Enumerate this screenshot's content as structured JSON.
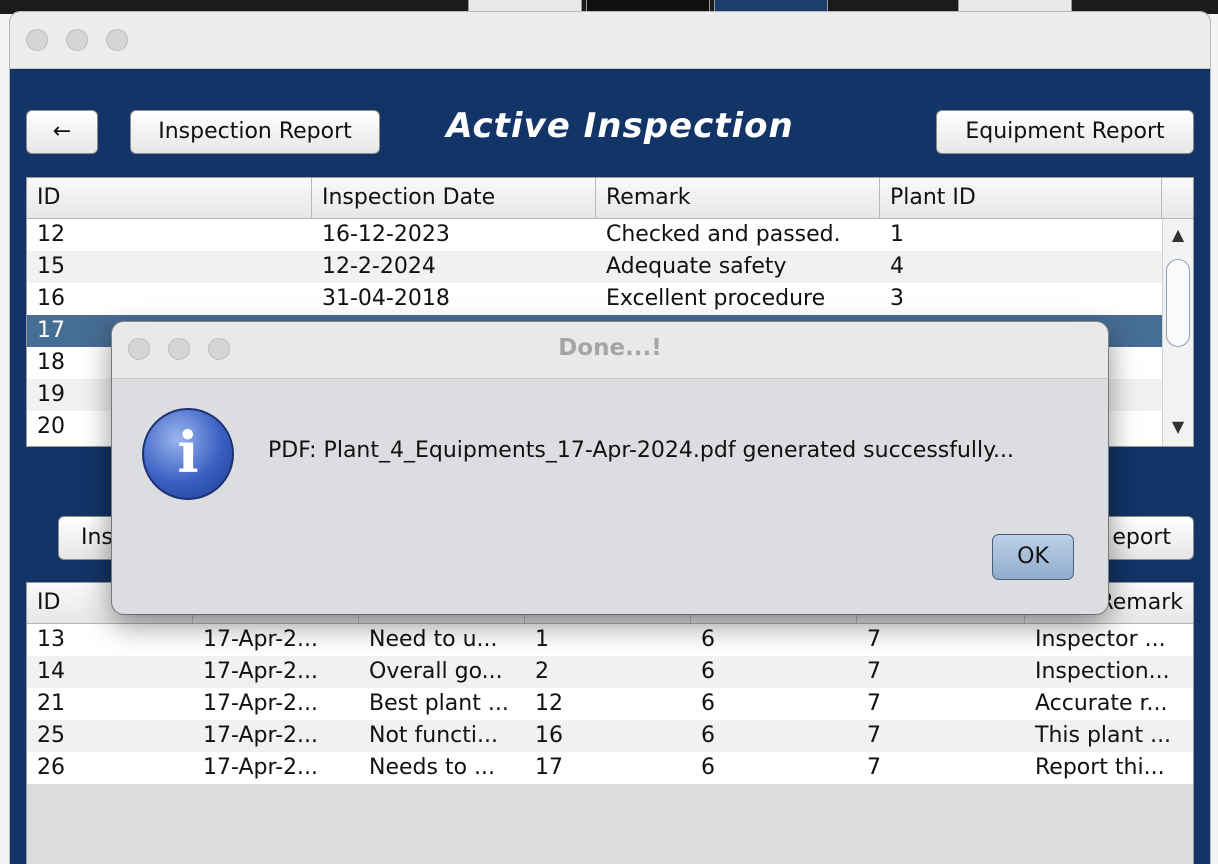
{
  "window": {
    "heading": "Active Inspection",
    "back_label": "←",
    "inspection_report_label": "Inspection Report",
    "equipment_report_label": "Equipment Report"
  },
  "top_table": {
    "columns": [
      "ID",
      "Inspection Date",
      "Remark",
      "Plant ID"
    ],
    "rows": [
      {
        "id": "12",
        "date": "16-12-2023",
        "remark": "Checked and passed.",
        "plant": "1"
      },
      {
        "id": "15",
        "date": "12-2-2024",
        "remark": "Adequate safety",
        "plant": "4"
      },
      {
        "id": "16",
        "date": "31-04-2018",
        "remark": "Excellent procedure",
        "plant": "3"
      },
      {
        "id": "17",
        "date": "",
        "remark": "",
        "plant": ""
      },
      {
        "id": "18",
        "date": "",
        "remark": "",
        "plant": ""
      },
      {
        "id": "19",
        "date": "",
        "remark": "",
        "plant": ""
      },
      {
        "id": "20",
        "date": "",
        "remark": "",
        "plant": ""
      }
    ]
  },
  "bottom_buttons": {
    "left_label": "Ins",
    "right_label": "eport"
  },
  "bottom_table": {
    "columns": [
      "ID",
      "",
      "",
      "",
      "",
      "",
      "Remark"
    ],
    "remark_header_visible": "Remark",
    "rows": [
      {
        "c1": "13",
        "c2": "17-Apr-2...",
        "c3": "Need to u...",
        "c4": "1",
        "c5": "6",
        "c6": "7",
        "c7": "Inspector ..."
      },
      {
        "c1": "14",
        "c2": "17-Apr-2...",
        "c3": "Overall go...",
        "c4": "2",
        "c5": "6",
        "c6": "7",
        "c7": "Inspection..."
      },
      {
        "c1": "21",
        "c2": "17-Apr-2...",
        "c3": "Best plant ...",
        "c4": "12",
        "c5": "6",
        "c6": "7",
        "c7": "Accurate r..."
      },
      {
        "c1": "25",
        "c2": "17-Apr-2...",
        "c3": "Not functi...",
        "c4": "16",
        "c5": "6",
        "c6": "7",
        "c7": "This plant ..."
      },
      {
        "c1": "26",
        "c2": "17-Apr-2...",
        "c3": "Needs to ...",
        "c4": "17",
        "c5": "6",
        "c6": "7",
        "c7": "Report thi..."
      }
    ]
  },
  "dialog": {
    "title": "Done...!",
    "message": "PDF: Plant_4_Equipments_17-Apr-2024.pdf generated successfully...",
    "ok_label": "OK",
    "icon": "info-icon"
  },
  "colors": {
    "window_bg": "#123466",
    "selected_row": "#466d94",
    "dialog_bg": "#dcdde0",
    "ok_button": "#a6bedb"
  }
}
